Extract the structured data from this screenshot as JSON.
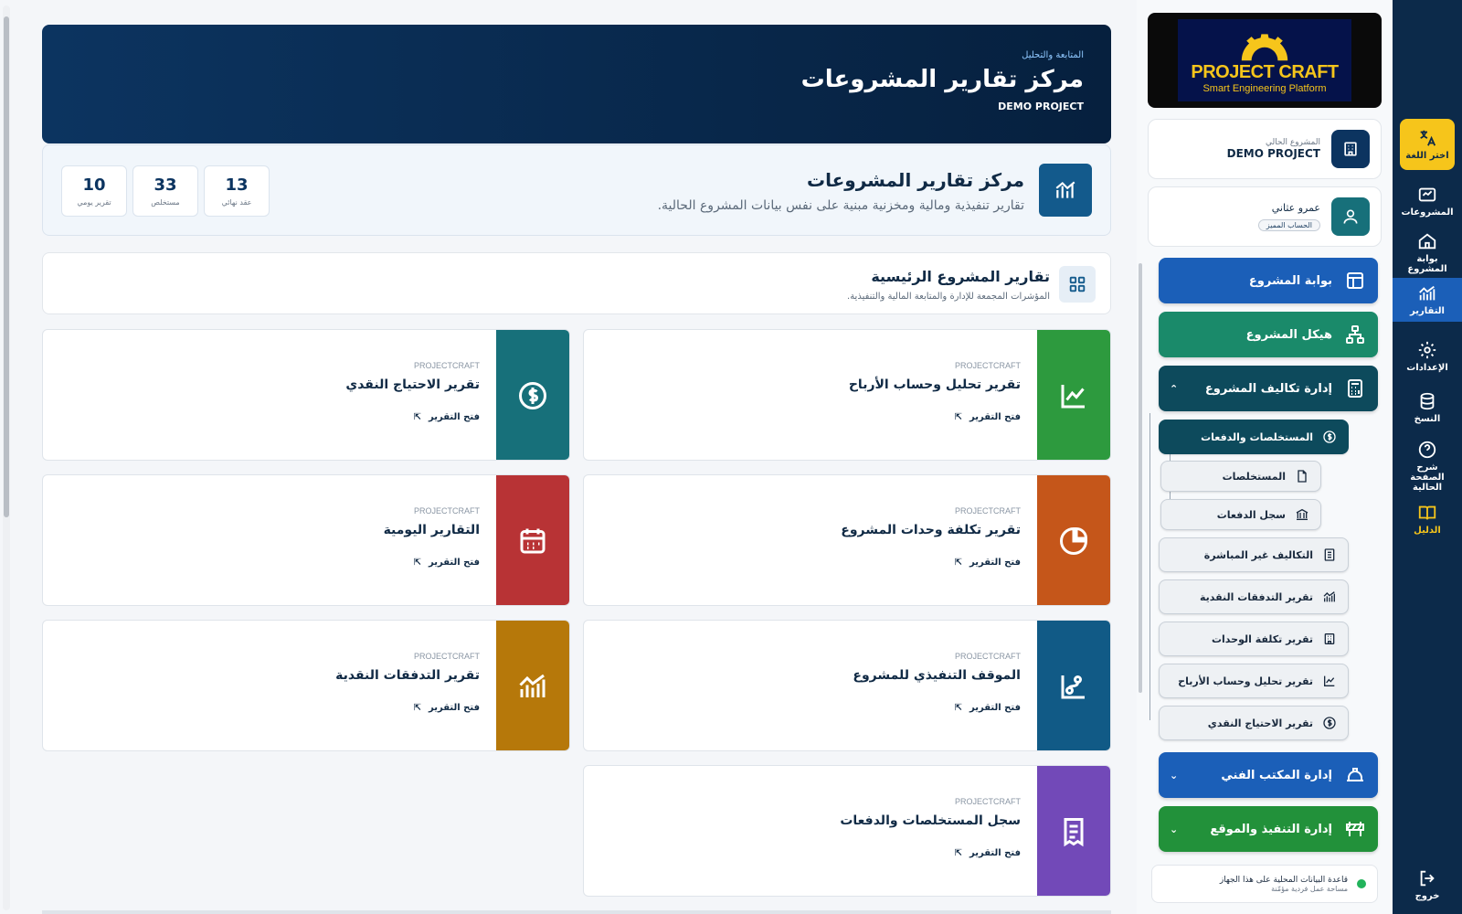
{
  "rail": {
    "lang": "اختر اللغة",
    "projects": "المشروعات",
    "portal": "بوابة المشروع",
    "reports": "التقارير",
    "settings": "الإعدادات",
    "backup": "النسخ",
    "explain": "شرح الصفحة الحالية",
    "guide": "الدليل",
    "logout": "خروج"
  },
  "logo": {
    "title": "PROJECT CRAFT",
    "subtitle": "Smart Engineering Platform"
  },
  "current_project": {
    "label": "المشروع الحالي",
    "name": "DEMO PROJECT"
  },
  "user": {
    "name": "عمرو عثاني",
    "badge": "الحساب المميز"
  },
  "menu": {
    "portal": "بوابة المشروع",
    "structure": "هيكل المشروع",
    "costs": "إدارة تكاليف المشروع",
    "costs_sub": [
      "المستخلصات والدفعات",
      "المستخلصات",
      "سجل الدفعات",
      "التكاليف غير المباشرة",
      "تقرير التدفقات النقدية",
      "تقرير تكلفة الوحدات",
      "تقرير تحليل وحساب الأرباح",
      "تقرير الاحتياج النقدي"
    ],
    "technical": "إدارة المكتب الفني",
    "execution": "إدارة التنفيذ والموقع"
  },
  "db": {
    "title": "قاعدة البيانات المحلية على هذا الجهاز",
    "subtitle": "مساحة عمل فردية مؤمّنة"
  },
  "hero": {
    "kicker": "المتابعة والتحليل",
    "title": "مركز تقارير المشروعات",
    "project": "DEMO PROJECT"
  },
  "info": {
    "title": "مركز تقارير المشروعات",
    "desc": "تقارير تنفيذية ومالية ومخزنية مبنية على نفس بيانات المشروع الحالية.",
    "stats": [
      {
        "value": "13",
        "label": "عقد نهائي"
      },
      {
        "value": "33",
        "label": "مستخلص"
      },
      {
        "value": "10",
        "label": "تقرير يومي"
      }
    ]
  },
  "section": {
    "title": "تقارير المشروع الرئيسية",
    "desc": "المؤشرات المجمعة للإدارة والمتابعة المالية والتنفيذية."
  },
  "reports": {
    "brand": "PROJECTCRAFT",
    "open": "فتح التقرير",
    "items": [
      {
        "title": "تقرير تحليل وحساب الأرباح",
        "color": "#2d9a3e",
        "icon": "line-chart-icon"
      },
      {
        "title": "تقرير الاحتياج النقدي",
        "color": "#17707a",
        "icon": "dollar-circle-icon"
      },
      {
        "title": "تقرير تكلفة وحدات المشروع",
        "color": "#c5561a",
        "icon": "pie-chart-icon"
      },
      {
        "title": "التقارير اليومية",
        "color": "#b83335",
        "icon": "calendar-icon"
      },
      {
        "title": "الموقف التنفيذي للمشروع",
        "color": "#115a86",
        "icon": "route-icon"
      },
      {
        "title": "تقرير التدفقات النقدية",
        "color": "#b6780a",
        "icon": "bar-trend-icon"
      },
      {
        "title": "سجل المستخلصات والدفعات",
        "color": "#7249b8",
        "icon": "receipt-icon"
      }
    ]
  }
}
